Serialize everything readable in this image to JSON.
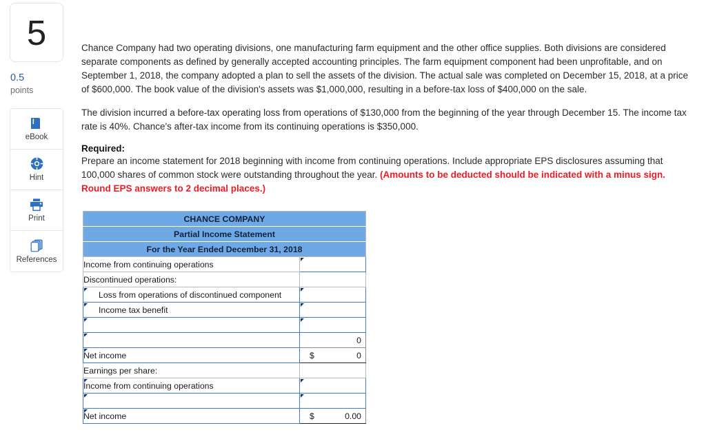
{
  "question": {
    "number": "5",
    "points_value": "0.5",
    "points_label": "points"
  },
  "tools": [
    {
      "name": "ebook",
      "label": "eBook",
      "icon": "book-icon"
    },
    {
      "name": "hint",
      "label": "Hint",
      "icon": "lifebuoy-icon"
    },
    {
      "name": "print",
      "label": "Print",
      "icon": "printer-icon"
    },
    {
      "name": "references",
      "label": "References",
      "icon": "copy-icon"
    }
  ],
  "problem": {
    "paragraph1": "Chance Company had two operating divisions, one manufacturing farm equipment and the other office supplies. Both divisions are considered separate components as defined by generally accepted accounting principles. The farm equipment component had been unprofitable, and on September 1, 2018, the company adopted a plan to sell the assets of the division. The actual sale was completed on December 15, 2018, at a price of $600,000. The book value of the division's assets was $1,000,000, resulting in a before-tax loss of $400,000 on the sale.",
    "paragraph2": "The division incurred a before-tax operating loss from operations of $130,000 from the beginning of the year through December 15. The income tax rate is 40%. Chance's after-tax income from its continuing operations is $350,000.",
    "required_heading": "Required:",
    "required_text": "Prepare an income statement for 2018 beginning with income from continuing operations. Include appropriate EPS disclosures assuming that 100,000 shares of common stock were outstanding throughout the year. ",
    "required_note": "(Amounts to be deducted should be indicated with a minus sign. Round EPS answers to 2 decimal places.)"
  },
  "statement": {
    "header_lines": [
      "CHANCE COMPANY",
      "Partial Income Statement",
      "For the Year Ended December 31, 2018"
    ],
    "rows": [
      {
        "label": "Income from continuing operations",
        "label_type": "static",
        "indent": false,
        "value": "",
        "value_type": "edit",
        "dollar": ""
      },
      {
        "label": "Discontinued operations:",
        "label_type": "static",
        "indent": false,
        "value": "",
        "value_type": "plain",
        "dollar": ""
      },
      {
        "label": "Loss from operations of discontinued component",
        "label_type": "edit",
        "indent": true,
        "value": "",
        "value_type": "edit",
        "dollar": ""
      },
      {
        "label": "Income tax benefit",
        "label_type": "edit",
        "indent": true,
        "value": "",
        "value_type": "edit",
        "dollar": ""
      },
      {
        "label": "",
        "label_type": "edit",
        "indent": false,
        "value": "",
        "value_type": "edit",
        "dollar": ""
      },
      {
        "label": "",
        "label_type": "edit",
        "indent": false,
        "value": "0",
        "value_type": "result",
        "dollar": ""
      },
      {
        "label": "Net income",
        "label_type": "edit",
        "indent": false,
        "value": "0",
        "value_type": "result-dbl",
        "dollar": "$"
      },
      {
        "label": "Earnings per share:",
        "label_type": "static",
        "indent": false,
        "value": "",
        "value_type": "plain",
        "dollar": ""
      },
      {
        "label": "Income from continuing operations",
        "label_type": "edit",
        "indent": false,
        "value": "",
        "value_type": "edit",
        "dollar": ""
      },
      {
        "label": "",
        "label_type": "edit",
        "indent": false,
        "value": "",
        "value_type": "edit",
        "dollar": ""
      },
      {
        "label": "Net income",
        "label_type": "edit",
        "indent": false,
        "value": "0.00",
        "value_type": "result-dbl",
        "dollar": "$"
      }
    ]
  },
  "colors": {
    "header_blue": "#6ea8e5",
    "accent_blue": "#3f7cc0",
    "points_blue": "#2b5c9e",
    "note_red": "#ec1c24"
  }
}
